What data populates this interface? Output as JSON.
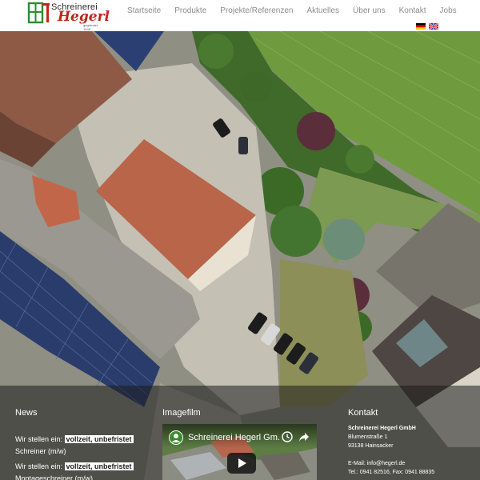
{
  "logo": {
    "line1": "Schreinerei",
    "line2": "Hegerl",
    "line3": "gegründet 1948"
  },
  "nav": {
    "items": [
      "Startseite",
      "Produkte",
      "Projekte/Referenzen",
      "Aktuelles",
      "Über uns",
      "Kontakt",
      "Jobs"
    ]
  },
  "languages": [
    "de-flag-icon",
    "gb-flag-icon"
  ],
  "footer": {
    "news": {
      "title": "News",
      "items": [
        {
          "prefix": "Wir stellen ein:",
          "highlight": "vollzeit, unbefristet",
          "role": "Schreiner (m/w)"
        },
        {
          "prefix": "Wir stellen ein:",
          "highlight": "vollzeit, unbefristet",
          "role": "Montageschreiner (m/w)"
        }
      ]
    },
    "imagefilm": {
      "title": "Imagefilm",
      "video_title": "Schreinerei Hegerl Gm..."
    },
    "contact": {
      "title": "Kontakt",
      "company": "Schreinerei Hegerl GmbH",
      "street": "Blumenstraße 1",
      "city": "93138 Hainsacker",
      "email": "E-Mail: info@hegerl.de",
      "phone": "Tel.: 0941 82516, Fax: 0941 88835"
    }
  },
  "colors": {
    "logo_red": "#c3241c",
    "logo_green": "#2e8b2e",
    "nav_text": "#8c8c8c",
    "highlight_bg": "#ffffff"
  }
}
